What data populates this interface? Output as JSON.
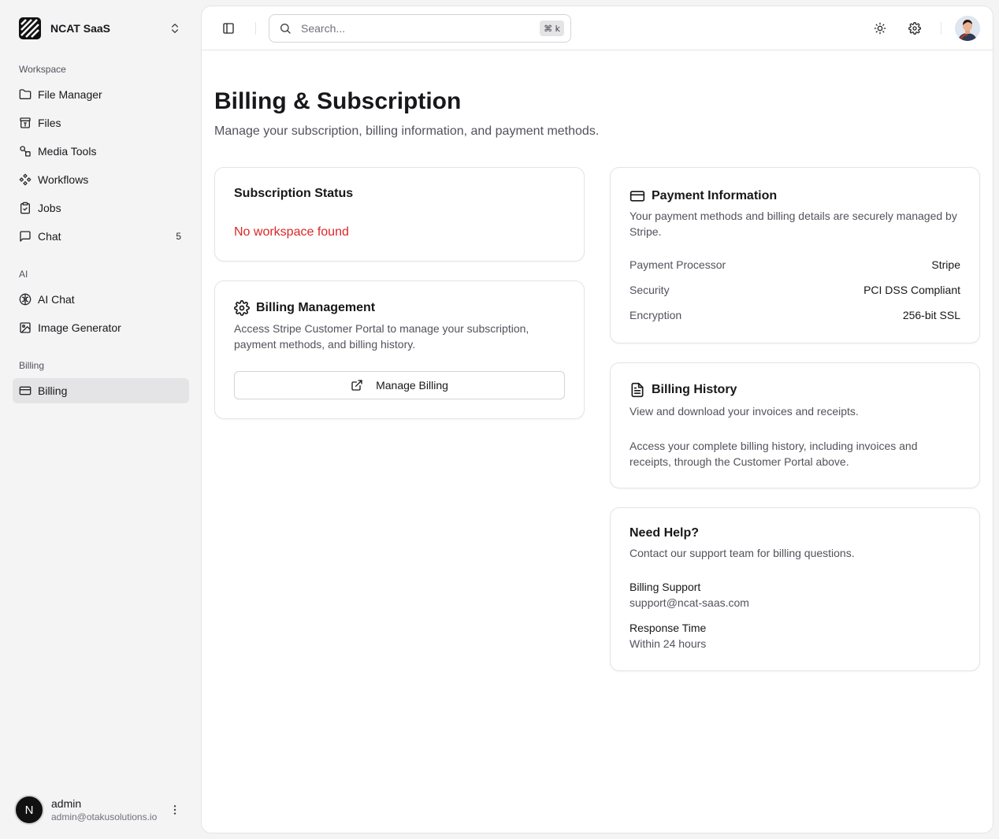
{
  "brand": {
    "name": "NCAT SaaS"
  },
  "sidebar": {
    "groups": [
      {
        "label": "Workspace"
      },
      {
        "label": "AI"
      },
      {
        "label": "Billing"
      }
    ],
    "items": [
      {
        "label": "File Manager",
        "icon": "folder-icon"
      },
      {
        "label": "Files",
        "icon": "file-box-icon"
      },
      {
        "label": "Media Tools",
        "icon": "shapes-icon"
      },
      {
        "label": "Workflows",
        "icon": "workflow-icon"
      },
      {
        "label": "Jobs",
        "icon": "clipboard-check-icon"
      },
      {
        "label": "Chat",
        "icon": "message-square-icon",
        "badge": "5"
      },
      {
        "label": "AI Chat",
        "icon": "brain-icon"
      },
      {
        "label": "Image Generator",
        "icon": "image-icon"
      },
      {
        "label": "Billing",
        "icon": "credit-card-icon",
        "active": true
      }
    ]
  },
  "user": {
    "initial": "N",
    "name": "admin",
    "email": "admin@otakusolutions.io"
  },
  "topbar": {
    "search_placeholder": "Search...",
    "shortcut": "⌘ k"
  },
  "page": {
    "title": "Billing & Subscription",
    "subtitle": "Manage your subscription, billing information, and payment methods."
  },
  "subscription": {
    "title": "Subscription Status",
    "error": "No workspace found"
  },
  "billing_management": {
    "title": "Billing Management",
    "description": "Access Stripe Customer Portal to manage your subscription, payment methods, and billing history.",
    "button": "Manage Billing"
  },
  "payment_info": {
    "title": "Payment Information",
    "description": "Your payment methods and billing details are securely managed by Stripe.",
    "rows": [
      {
        "key": "Payment Processor",
        "value": "Stripe"
      },
      {
        "key": "Security",
        "value": "PCI DSS Compliant"
      },
      {
        "key": "Encryption",
        "value": "256-bit SSL"
      }
    ]
  },
  "billing_history": {
    "title": "Billing History",
    "description": "View and download your invoices and receipts.",
    "body": "Access your complete billing history, including invoices and receipts, through the Customer Portal above."
  },
  "help": {
    "title": "Need Help?",
    "description": "Contact our support team for billing questions.",
    "support_label": "Billing Support",
    "support_value": "support@ncat-saas.com",
    "response_label": "Response Time",
    "response_value": "Within 24 hours"
  },
  "colors": {
    "error": "#dc2626",
    "active_bg": "#e4e4e7",
    "sidebar_bg": "#f4f4f5"
  }
}
